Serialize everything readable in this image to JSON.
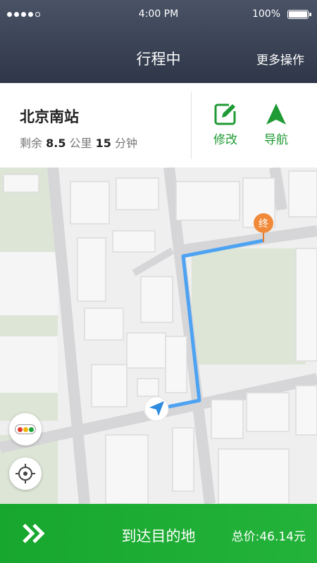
{
  "status_bar": {
    "time": "4:00 PM",
    "battery": "100%"
  },
  "header": {
    "title": "行程中",
    "more_label": "更多操作"
  },
  "trip": {
    "destination": "北京南站",
    "remaining_prefix": "剩余",
    "distance": "8.5",
    "distance_unit": "公里",
    "duration": "15",
    "duration_unit": "分钟",
    "edit_label": "修改",
    "nav_label": "导航"
  },
  "map": {
    "end_marker": "终",
    "traffic_icon": "traffic-light-icon",
    "locate_icon": "locate-icon",
    "car_icon": "navigation-arrow-icon"
  },
  "footer": {
    "action_label": "到达目的地",
    "price_label": "总价:46.14元"
  },
  "colors": {
    "brand_green": "#1f9a34",
    "route_blue": "#4da3f2",
    "marker_orange": "#f08a3a",
    "header_dark": "#2e3648"
  }
}
